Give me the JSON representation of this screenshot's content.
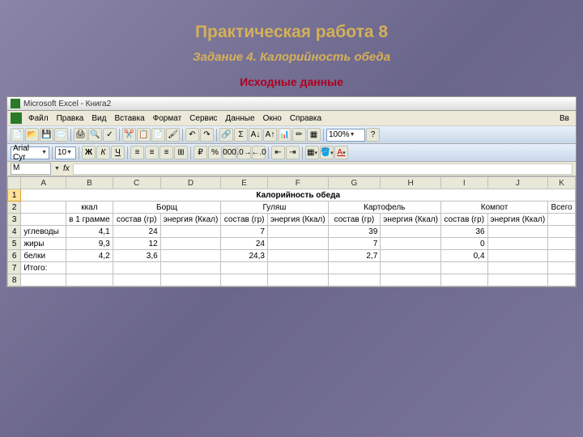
{
  "slide": {
    "title": "Практическая работа 8",
    "subtitle": "Задание 4. Калорийность обеда",
    "section": "Исходные данные"
  },
  "window": {
    "title": "Microsoft Excel - Книга2"
  },
  "menu": {
    "file": "Файл",
    "edit": "Правка",
    "view": "Вид",
    "insert": "Вставка",
    "format": "Формат",
    "tools": "Сервис",
    "data": "Данные",
    "window": "Окно",
    "help": "Справка",
    "right": "Вв"
  },
  "toolbar": {
    "zoom": "100%"
  },
  "format": {
    "font": "Arial Cyr",
    "size": "10",
    "bold": "Ж",
    "italic": "К",
    "underline": "Ч"
  },
  "formula": {
    "name": "M",
    "fx": "fx",
    "content": ""
  },
  "cols": [
    "A",
    "B",
    "C",
    "D",
    "E",
    "F",
    "G",
    "H",
    "I",
    "J",
    "K"
  ],
  "sheet": {
    "title": "Калорийность обеда",
    "h1_kcal": "ккал",
    "h1_borsch": "Борщ",
    "h1_gulash": "Гуляш",
    "h1_potato": "Картофель",
    "h1_compot": "Компот",
    "h1_total": "Всего",
    "h2_b": "в 1 грамме",
    "h2_sostav": "состав (гр)",
    "h2_energy": "энергия (Ккал)",
    "r4": {
      "label": "углеводы",
      "b": "4,1",
      "c": "24",
      "e": "7",
      "g": "39",
      "i": "36"
    },
    "r5": {
      "label": "жиры",
      "b": "9,3",
      "c": "12",
      "e": "24",
      "g": "7",
      "i": "0"
    },
    "r6": {
      "label": "белки",
      "b": "4,2",
      "c": "3,6",
      "e": "24,3",
      "g": "2,7",
      "i": "0,4"
    },
    "r7": {
      "label": "Итого:"
    }
  },
  "chart_data": {
    "type": "table",
    "title": "Калорийность обеда",
    "columns": [
      "",
      "ккал в 1 грамме",
      "Борщ состав (гр)",
      "Борщ энергия (Ккал)",
      "Гуляш состав (гр)",
      "Гуляш энергия (Ккал)",
      "Картофель состав (гр)",
      "Картофель энергия (Ккал)",
      "Компот состав (гр)",
      "Компот энергия (Ккал)",
      "Всего"
    ],
    "rows": [
      [
        "углеводы",
        4.1,
        24,
        null,
        7,
        null,
        39,
        null,
        36,
        null,
        null
      ],
      [
        "жиры",
        9.3,
        12,
        null,
        24,
        null,
        7,
        null,
        0,
        null,
        null
      ],
      [
        "белки",
        4.2,
        3.6,
        null,
        24.3,
        null,
        2.7,
        null,
        0.4,
        null,
        null
      ],
      [
        "Итого:",
        null,
        null,
        null,
        null,
        null,
        null,
        null,
        null,
        null,
        null
      ]
    ]
  }
}
